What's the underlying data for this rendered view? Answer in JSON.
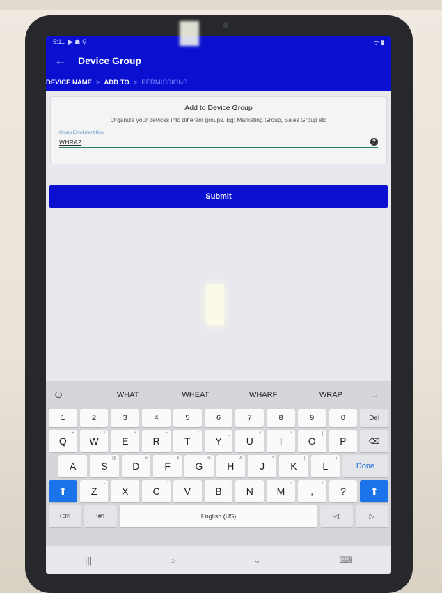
{
  "status": {
    "time": "5:11",
    "left_icons": "▶ ☗ ⚲",
    "right_icons": "ᯤ ▮"
  },
  "appbar": {
    "back_icon": "←",
    "title": "Device Group"
  },
  "steps": {
    "step1": "DEVICE NAME",
    "sep1": ">",
    "step2": "ADD TO",
    "sep2": ">",
    "step3": "PERMISSIONS"
  },
  "card": {
    "title": "Add to Device Group",
    "subtitle": "Organize your devices into different groups. Eg: Marketing Group, Sales Group etc",
    "field_label": "Group Enrollment Key",
    "field_value": "WHRA2",
    "help_icon": "?"
  },
  "submit_label": "Submit",
  "keyboard": {
    "emoji_icon": "☺",
    "suggestions": [
      "WHAT",
      "WHEAT",
      "WHARF",
      "WRAP"
    ],
    "more": "...",
    "numbers": [
      "1",
      "2",
      "3",
      "4",
      "5",
      "6",
      "7",
      "8",
      "9",
      "0"
    ],
    "del": "Del",
    "row1": [
      "Q",
      "W",
      "E",
      "R",
      "T",
      "Y",
      "U",
      "I",
      "O",
      "P"
    ],
    "row1_sub": [
      "+",
      "×",
      "÷",
      "=",
      "/",
      "_",
      "<",
      ">",
      "[",
      "]"
    ],
    "backspace_icon": "⌫",
    "row2": [
      "A",
      "S",
      "D",
      "F",
      "G",
      "H",
      "J",
      "K",
      "L"
    ],
    "row2_sub": [
      "!",
      "@",
      "#",
      "$",
      "%",
      "&",
      "*",
      "(",
      ")"
    ],
    "done": "Done",
    "shift_icon": "⬆",
    "row3": [
      "Z",
      "X",
      "C",
      "V",
      "B",
      "N",
      "M",
      ",",
      "?"
    ],
    "row3_sub": [
      "-",
      "'",
      "\"",
      ":",
      ";",
      "",
      "~",
      "!",
      "?"
    ],
    "ctrl": "Ctrl",
    "symbols": "!#1",
    "space": "English (US)",
    "left_icon": "◁",
    "right_icon": "▷"
  },
  "navbar": {
    "recents": "|||",
    "home": "○",
    "back": "⌄",
    "keyboard_icon": "⌨"
  }
}
